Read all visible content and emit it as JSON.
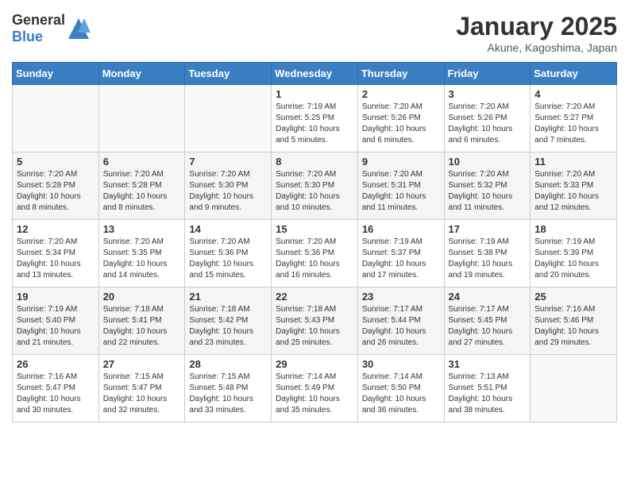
{
  "header": {
    "logo_general": "General",
    "logo_blue": "Blue",
    "title": "January 2025",
    "subtitle": "Akune, Kagoshima, Japan"
  },
  "weekdays": [
    "Sunday",
    "Monday",
    "Tuesday",
    "Wednesday",
    "Thursday",
    "Friday",
    "Saturday"
  ],
  "weeks": [
    [
      {
        "day": "",
        "info": ""
      },
      {
        "day": "",
        "info": ""
      },
      {
        "day": "",
        "info": ""
      },
      {
        "day": "1",
        "info": "Sunrise: 7:19 AM\nSunset: 5:25 PM\nDaylight: 10 hours and 5 minutes."
      },
      {
        "day": "2",
        "info": "Sunrise: 7:20 AM\nSunset: 5:26 PM\nDaylight: 10 hours and 6 minutes."
      },
      {
        "day": "3",
        "info": "Sunrise: 7:20 AM\nSunset: 5:26 PM\nDaylight: 10 hours and 6 minutes."
      },
      {
        "day": "4",
        "info": "Sunrise: 7:20 AM\nSunset: 5:27 PM\nDaylight: 10 hours and 7 minutes."
      }
    ],
    [
      {
        "day": "5",
        "info": "Sunrise: 7:20 AM\nSunset: 5:28 PM\nDaylight: 10 hours and 8 minutes."
      },
      {
        "day": "6",
        "info": "Sunrise: 7:20 AM\nSunset: 5:28 PM\nDaylight: 10 hours and 8 minutes."
      },
      {
        "day": "7",
        "info": "Sunrise: 7:20 AM\nSunset: 5:30 PM\nDaylight: 10 hours and 9 minutes."
      },
      {
        "day": "8",
        "info": "Sunrise: 7:20 AM\nSunset: 5:30 PM\nDaylight: 10 hours and 10 minutes."
      },
      {
        "day": "9",
        "info": "Sunrise: 7:20 AM\nSunset: 5:31 PM\nDaylight: 10 hours and 11 minutes."
      },
      {
        "day": "10",
        "info": "Sunrise: 7:20 AM\nSunset: 5:32 PM\nDaylight: 10 hours and 11 minutes."
      },
      {
        "day": "11",
        "info": "Sunrise: 7:20 AM\nSunset: 5:33 PM\nDaylight: 10 hours and 12 minutes."
      }
    ],
    [
      {
        "day": "12",
        "info": "Sunrise: 7:20 AM\nSunset: 5:34 PM\nDaylight: 10 hours and 13 minutes."
      },
      {
        "day": "13",
        "info": "Sunrise: 7:20 AM\nSunset: 5:35 PM\nDaylight: 10 hours and 14 minutes."
      },
      {
        "day": "14",
        "info": "Sunrise: 7:20 AM\nSunset: 5:36 PM\nDaylight: 10 hours and 15 minutes."
      },
      {
        "day": "15",
        "info": "Sunrise: 7:20 AM\nSunset: 5:36 PM\nDaylight: 10 hours and 16 minutes."
      },
      {
        "day": "16",
        "info": "Sunrise: 7:19 AM\nSunset: 5:37 PM\nDaylight: 10 hours and 17 minutes."
      },
      {
        "day": "17",
        "info": "Sunrise: 7:19 AM\nSunset: 5:38 PM\nDaylight: 10 hours and 19 minutes."
      },
      {
        "day": "18",
        "info": "Sunrise: 7:19 AM\nSunset: 5:39 PM\nDaylight: 10 hours and 20 minutes."
      }
    ],
    [
      {
        "day": "19",
        "info": "Sunrise: 7:19 AM\nSunset: 5:40 PM\nDaylight: 10 hours and 21 minutes."
      },
      {
        "day": "20",
        "info": "Sunrise: 7:18 AM\nSunset: 5:41 PM\nDaylight: 10 hours and 22 minutes."
      },
      {
        "day": "21",
        "info": "Sunrise: 7:18 AM\nSunset: 5:42 PM\nDaylight: 10 hours and 23 minutes."
      },
      {
        "day": "22",
        "info": "Sunrise: 7:18 AM\nSunset: 5:43 PM\nDaylight: 10 hours and 25 minutes."
      },
      {
        "day": "23",
        "info": "Sunrise: 7:17 AM\nSunset: 5:44 PM\nDaylight: 10 hours and 26 minutes."
      },
      {
        "day": "24",
        "info": "Sunrise: 7:17 AM\nSunset: 5:45 PM\nDaylight: 10 hours and 27 minutes."
      },
      {
        "day": "25",
        "info": "Sunrise: 7:16 AM\nSunset: 5:46 PM\nDaylight: 10 hours and 29 minutes."
      }
    ],
    [
      {
        "day": "26",
        "info": "Sunrise: 7:16 AM\nSunset: 5:47 PM\nDaylight: 10 hours and 30 minutes."
      },
      {
        "day": "27",
        "info": "Sunrise: 7:15 AM\nSunset: 5:47 PM\nDaylight: 10 hours and 32 minutes."
      },
      {
        "day": "28",
        "info": "Sunrise: 7:15 AM\nSunset: 5:48 PM\nDaylight: 10 hours and 33 minutes."
      },
      {
        "day": "29",
        "info": "Sunrise: 7:14 AM\nSunset: 5:49 PM\nDaylight: 10 hours and 35 minutes."
      },
      {
        "day": "30",
        "info": "Sunrise: 7:14 AM\nSunset: 5:50 PM\nDaylight: 10 hours and 36 minutes."
      },
      {
        "day": "31",
        "info": "Sunrise: 7:13 AM\nSunset: 5:51 PM\nDaylight: 10 hours and 38 minutes."
      },
      {
        "day": "",
        "info": ""
      }
    ]
  ]
}
